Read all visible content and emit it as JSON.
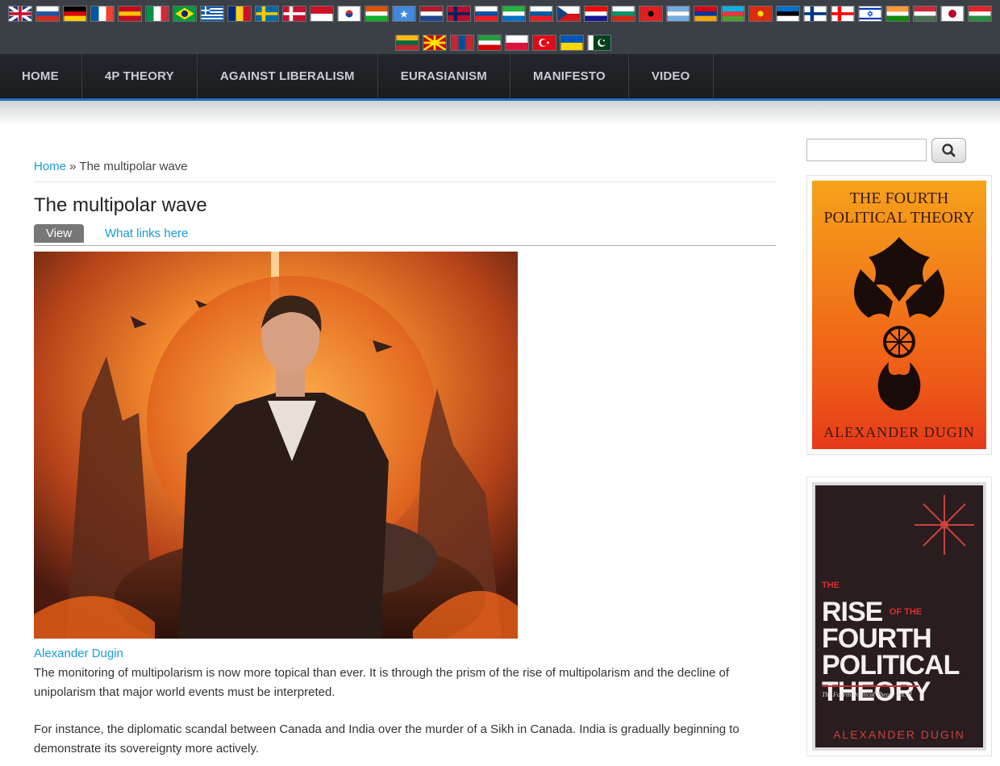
{
  "flags_row1": [
    {
      "name": "uk-flag",
      "c1": "#1f3a8a",
      "c2": "#ffffff",
      "c3": "#c8102e",
      "type": "uk"
    },
    {
      "name": "russia-flag",
      "c1": "#ffffff",
      "c2": "#1c57a5",
      "c3": "#d52b1e",
      "type": "h3"
    },
    {
      "name": "germany-flag",
      "c1": "#000000",
      "c2": "#dd0000",
      "c3": "#ffce00",
      "type": "h3"
    },
    {
      "name": "france-flag",
      "c1": "#0055a4",
      "c2": "#ffffff",
      "c3": "#ef4135",
      "type": "v3"
    },
    {
      "name": "spain-flag",
      "c1": "#c60b1e",
      "c2": "#ffc400",
      "c3": "#c60b1e",
      "type": "h3"
    },
    {
      "name": "italy-flag",
      "c1": "#009246",
      "c2": "#ffffff",
      "c3": "#ce2b37",
      "type": "v3"
    },
    {
      "name": "brazil-flag",
      "c1": "#009c3b",
      "c2": "#ffdf00",
      "c3": "#002776",
      "type": "brazil"
    },
    {
      "name": "greece-flag",
      "c1": "#0d5eaf",
      "c2": "#ffffff",
      "c3": "#0d5eaf",
      "type": "stripes"
    },
    {
      "name": "romania-flag",
      "c1": "#002b7f",
      "c2": "#fcd116",
      "c3": "#ce1126",
      "type": "v3"
    },
    {
      "name": "sweden-flag",
      "c1": "#006aa7",
      "c2": "#fecc00",
      "c3": "#006aa7",
      "type": "cross"
    },
    {
      "name": "denmark-flag",
      "c1": "#c8102e",
      "c2": "#ffffff",
      "c3": "#c8102e",
      "type": "cross"
    },
    {
      "name": "indonesia-flag",
      "c1": "#ce1126",
      "c2": "#ffffff",
      "c3": "#ffffff",
      "type": "h2"
    },
    {
      "name": "south-korea-flag",
      "c1": "#ffffff",
      "c2": "#cd2e3a",
      "c3": "#0047a0",
      "type": "korea"
    },
    {
      "name": "niger-flag",
      "c1": "#e05206",
      "c2": "#ffffff",
      "c3": "#0db02b",
      "type": "h3"
    },
    {
      "name": "somalia-flag",
      "c1": "#4189dd",
      "c2": "#ffffff",
      "c3": "#4189dd",
      "type": "star"
    },
    {
      "name": "netherlands-flag",
      "c1": "#ae1c28",
      "c2": "#ffffff",
      "c3": "#21468b",
      "type": "h3"
    },
    {
      "name": "norway-flag",
      "c1": "#ba0c2f",
      "c2": "#00205b",
      "c3": "#ffffff",
      "type": "cross"
    },
    {
      "name": "slovakia-flag",
      "c1": "#ffffff",
      "c2": "#0b4ea2",
      "c3": "#ee1c25",
      "type": "h3"
    },
    {
      "name": "sierra-leone-flag",
      "c1": "#1eb53a",
      "c2": "#ffffff",
      "c3": "#0072c6",
      "type": "h3"
    },
    {
      "name": "slovenia-flag",
      "c1": "#ffffff",
      "c2": "#005da4",
      "c3": "#ed1c24",
      "type": "h3"
    },
    {
      "name": "czech-flag",
      "c1": "#ffffff",
      "c2": "#d7141a",
      "c3": "#11457e",
      "type": "czech"
    },
    {
      "name": "croatia-flag",
      "c1": "#ff0000",
      "c2": "#ffffff",
      "c3": "#171796",
      "type": "h3"
    },
    {
      "name": "bulgaria-flag",
      "c1": "#ffffff",
      "c2": "#00966e",
      "c3": "#d62612",
      "type": "h3"
    },
    {
      "name": "albania-flag",
      "c1": "#e41e20",
      "c2": "#000000",
      "c3": "#e41e20",
      "type": "solid"
    },
    {
      "name": "argentina-flag",
      "c1": "#74acdf",
      "c2": "#ffffff",
      "c3": "#74acdf",
      "type": "h3"
    },
    {
      "name": "armenia-flag",
      "c1": "#d90012",
      "c2": "#0033a0",
      "c3": "#f2a800",
      "type": "h3"
    },
    {
      "name": "azerbaijan-flag",
      "c1": "#00b5e2",
      "c2": "#ef3340",
      "c3": "#509e2f",
      "type": "h3"
    },
    {
      "name": "china-flag",
      "c1": "#de2910",
      "c2": "#ffde00",
      "c3": "#de2910",
      "type": "solid"
    },
    {
      "name": "estonia-flag",
      "c1": "#0072ce",
      "c2": "#000000",
      "c3": "#ffffff",
      "type": "h3"
    },
    {
      "name": "finland-flag",
      "c1": "#ffffff",
      "c2": "#003580",
      "c3": "#ffffff",
      "type": "cross"
    },
    {
      "name": "georgia-flag",
      "c1": "#ffffff",
      "c2": "#ff0000",
      "c3": "#ffffff",
      "type": "cross"
    },
    {
      "name": "israel-flag",
      "c1": "#ffffff",
      "c2": "#0038b8",
      "c3": "#ffffff",
      "type": "israel"
    },
    {
      "name": "india-flag",
      "c1": "#ff9933",
      "c2": "#ffffff",
      "c3": "#138808",
      "type": "h3"
    },
    {
      "name": "hungary-flag",
      "c1": "#ce2939",
      "c2": "#ffffff",
      "c3": "#477050",
      "type": "h3"
    },
    {
      "name": "japan-flag",
      "c1": "#ffffff",
      "c2": "#bc002d",
      "c3": "#ffffff",
      "type": "japan"
    },
    {
      "name": "kurdistan-flag",
      "c1": "#ed2024",
      "c2": "#ffffff",
      "c3": "#278e43",
      "type": "h3"
    }
  ],
  "flags_row2": [
    {
      "name": "lithuania-flag",
      "c1": "#fdb913",
      "c2": "#006a44",
      "c3": "#c1272d",
      "type": "h3"
    },
    {
      "name": "macedonia-flag",
      "c1": "#d20000",
      "c2": "#ffe600",
      "c3": "#d20000",
      "type": "sun"
    },
    {
      "name": "mongolia-flag",
      "c1": "#c4272f",
      "c2": "#015197",
      "c3": "#c4272f",
      "type": "v3"
    },
    {
      "name": "iran-flag",
      "c1": "#239f40",
      "c2": "#ffffff",
      "c3": "#da0000",
      "type": "h3"
    },
    {
      "name": "poland-flag",
      "c1": "#ffffff",
      "c2": "#dc143c",
      "c3": "#dc143c",
      "type": "h2"
    },
    {
      "name": "turkey-flag",
      "c1": "#e30a17",
      "c2": "#ffffff",
      "c3": "#e30a17",
      "type": "crescent"
    },
    {
      "name": "ukraine-flag",
      "c1": "#0057b7",
      "c2": "#ffd700",
      "c3": "#ffd700",
      "type": "h2"
    },
    {
      "name": "pakistan-flag",
      "c1": "#ffffff",
      "c2": "#01411c",
      "c3": "#ffffff",
      "type": "pak"
    }
  ],
  "nav": [
    "HOME",
    "4P THEORY",
    "AGAINST LIBERALISM",
    "EURASIANISM",
    "MANIFESTO",
    "VIDEO"
  ],
  "breadcrumb": {
    "home": "Home",
    "sep": " » ",
    "current": "The multipolar wave"
  },
  "title": "The multipolar wave",
  "tabs": {
    "view": "View",
    "links": "What links here"
  },
  "author": "Alexander Dugin",
  "paragraphs": [
    "The monitoring of multipolarism is now more topical than ever. It is through the prism of the rise of multipolarism and the decline of unipolarism that major world events must be interpreted.",
    "For instance, the diplomatic scandal between Canada and India over the murder of a Sikh in Canada. India is gradually beginning to demonstrate its sovereignty more actively."
  ],
  "book1": {
    "title": "THE FOURTH POLITICAL THEORY",
    "author": "ALEXANDER DUGIN"
  },
  "book2": {
    "title_line1": "RISE",
    "title_small": "OF THE",
    "title_line2": "FOURTH",
    "title_line3": "POLITICAL",
    "title_line4": "THEORY",
    "the": "THE",
    "subtitle": "The Fourth Political Theory vol. II",
    "author": "ALEXANDER DUGIN"
  },
  "colors": {
    "link": "#1a9ad6",
    "nav_bg": "#1e2225",
    "nav_accent": "#1f6fbf"
  }
}
